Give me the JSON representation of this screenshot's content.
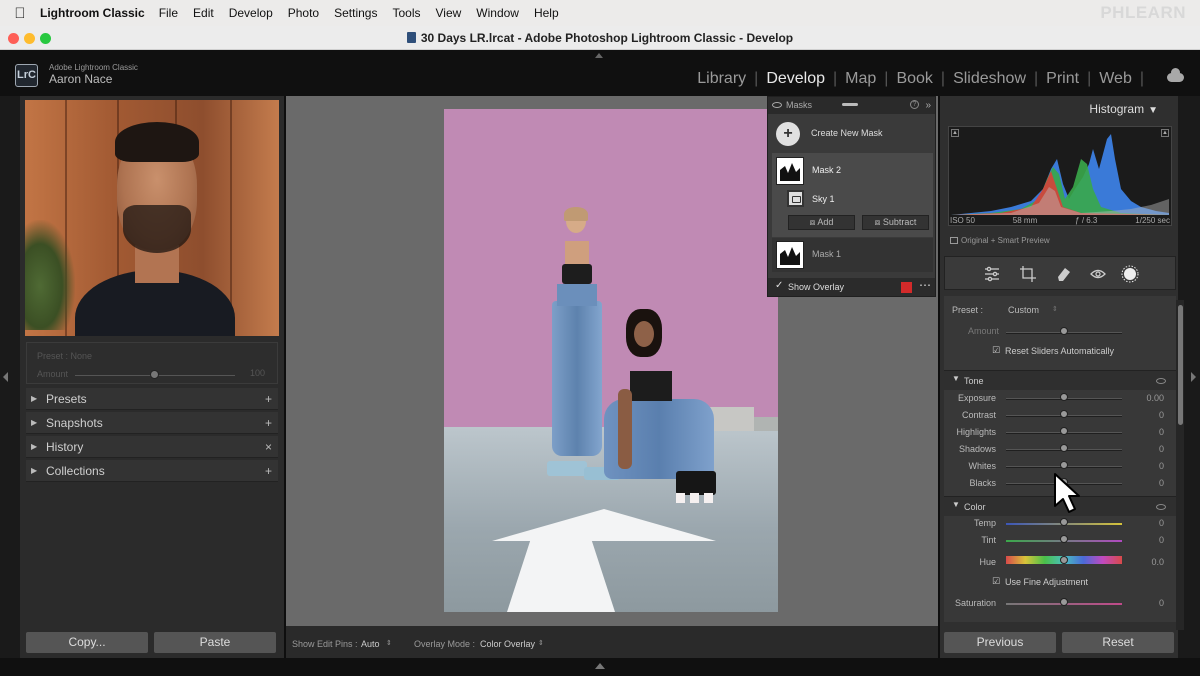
{
  "menubar": {
    "app_name": "Lightroom Classic",
    "items": [
      "File",
      "Edit",
      "Develop",
      "Photo",
      "Settings",
      "Tools",
      "View",
      "Window",
      "Help"
    ],
    "brand_watermark": "PHLEARN"
  },
  "window": {
    "title": "30 Days LR.lrcat - Adobe Photoshop Lightroom Classic - Develop"
  },
  "header": {
    "badge": "LrC",
    "product": "Adobe Lightroom Classic",
    "user": "Aaron Nace",
    "modules": [
      "Library",
      "Develop",
      "Map",
      "Book",
      "Slideshow",
      "Print",
      "Web"
    ],
    "active_module": "Develop"
  },
  "left_panel": {
    "preset_label": "Preset : None",
    "amount_label": "Amount",
    "amount_value": "100",
    "amount_fraction": 0.5,
    "sections": [
      {
        "label": "Presets",
        "action": "+"
      },
      {
        "label": "Snapshots",
        "action": "+"
      },
      {
        "label": "History",
        "action": "×"
      },
      {
        "label": "Collections",
        "action": "+"
      }
    ],
    "copy_label": "Copy...",
    "paste_label": "Paste"
  },
  "masks": {
    "title": "Masks",
    "create_label": "Create New Mask",
    "mask2_label": "Mask 2",
    "sky_label": "Sky 1",
    "add_label": "Add",
    "subtract_label": "Subtract",
    "mask1_label": "Mask 1",
    "show_overlay_label": "Show Overlay",
    "overlay_color": "#d22a2a"
  },
  "toolbar": {
    "edit_pins_label": "Show Edit Pins :",
    "edit_pins_value": "Auto",
    "overlay_mode_label": "Overlay Mode :",
    "overlay_mode_value": "Color Overlay"
  },
  "histogram": {
    "title": "Histogram",
    "iso": "ISO 50",
    "focal": "58 mm",
    "aperture": "ƒ / 6.3",
    "shutter": "1/250 sec",
    "preview": "Original + Smart Preview"
  },
  "adjust": {
    "preset_label": "Preset :",
    "preset_value": "Custom",
    "amount_label": "Amount",
    "reset_sliders_label": "Reset Sliders Automatically",
    "tone_title": "Tone",
    "tone_sliders": [
      {
        "label": "Exposure",
        "value": "0.00"
      },
      {
        "label": "Contrast",
        "value": "0"
      },
      {
        "label": "Highlights",
        "value": "0"
      },
      {
        "label": "Shadows",
        "value": "0"
      },
      {
        "label": "Whites",
        "value": "0"
      },
      {
        "label": "Blacks",
        "value": "0"
      }
    ],
    "color_title": "Color",
    "color_sliders": [
      {
        "label": "Temp",
        "value": "0"
      },
      {
        "label": "Tint",
        "value": "0"
      },
      {
        "label": "Hue",
        "value": "0.0"
      }
    ],
    "fine_adjust_label": "Use Fine Adjustment",
    "saturation_label": "Saturation",
    "saturation_value": "0",
    "previous_label": "Previous",
    "reset_label": "Reset"
  }
}
